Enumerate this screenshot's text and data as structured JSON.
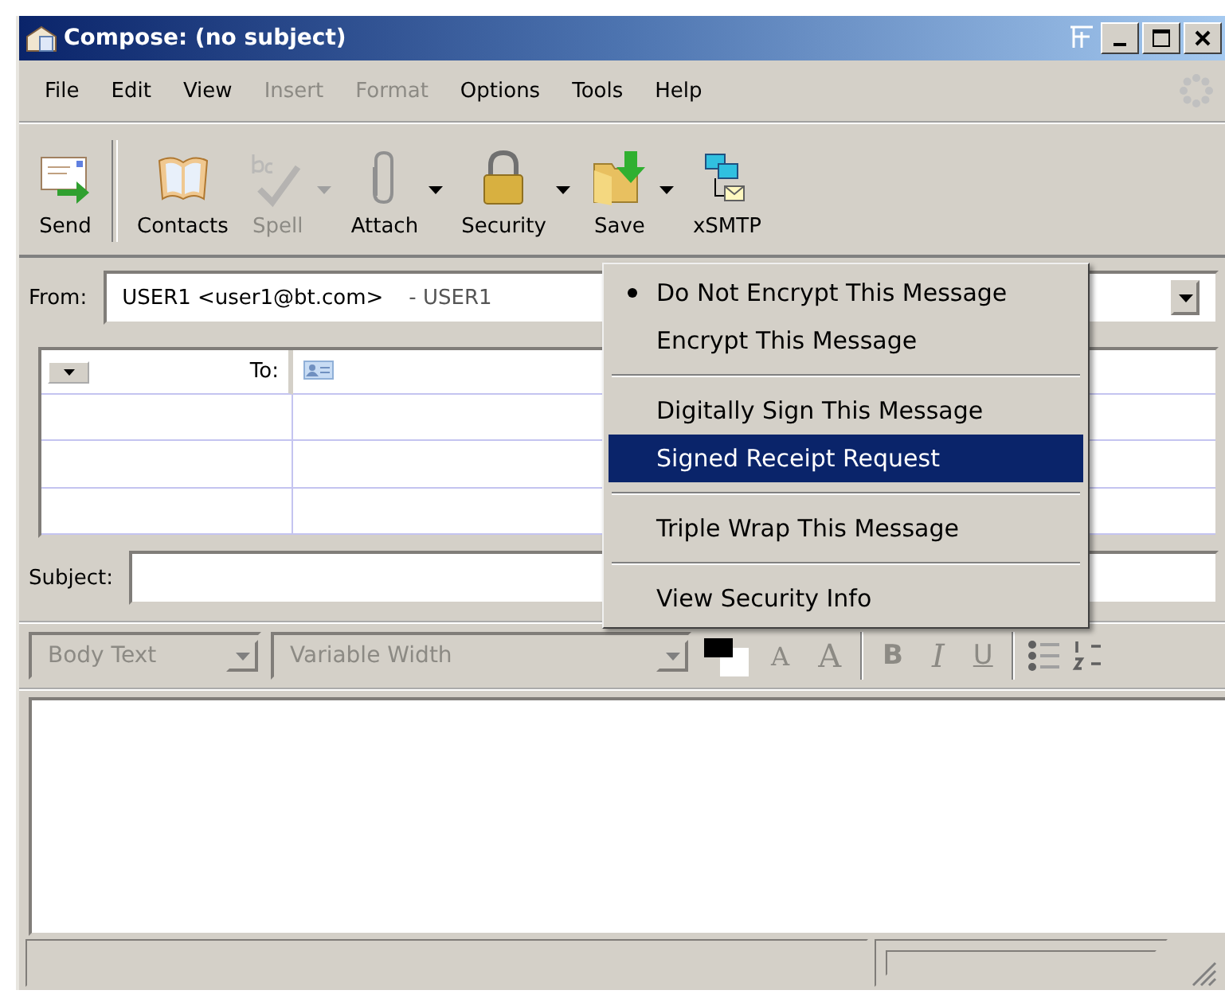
{
  "window": {
    "title": "Compose: (no subject)"
  },
  "menu_bar": [
    {
      "label": "File",
      "disabled": false
    },
    {
      "label": "Edit",
      "disabled": false
    },
    {
      "label": "View",
      "disabled": false
    },
    {
      "label": "Insert",
      "disabled": true
    },
    {
      "label": "Format",
      "disabled": true
    },
    {
      "label": "Options",
      "disabled": false
    },
    {
      "label": "Tools",
      "disabled": false
    },
    {
      "label": "Help",
      "disabled": false
    }
  ],
  "toolbar": [
    {
      "label": "Send",
      "disabled": false,
      "dropdown": false
    },
    {
      "label": "Contacts",
      "disabled": false,
      "dropdown": false
    },
    {
      "label": "Spell",
      "disabled": true,
      "dropdown": true
    },
    {
      "label": "Attach",
      "disabled": false,
      "dropdown": true
    },
    {
      "label": "Security",
      "disabled": false,
      "dropdown": true
    },
    {
      "label": "Save",
      "disabled": false,
      "dropdown": true
    },
    {
      "label": "xSMTP",
      "disabled": false,
      "dropdown": false
    }
  ],
  "from": {
    "label": "From:",
    "value": "USER1 <user1@bt.com>",
    "identity": "- USER1"
  },
  "addressing": {
    "type": "To:"
  },
  "subject": {
    "label": "Subject:"
  },
  "format_bar": {
    "disabled": true,
    "paragraph_style": "Body Text",
    "font": "Variable Width",
    "bold": "B",
    "italic": "I",
    "underline": "U",
    "smaller": "A",
    "larger": "A"
  },
  "security_menu": [
    {
      "kind": "item",
      "label": "Do Not Encrypt This Message",
      "checked": true,
      "highlighted": false
    },
    {
      "kind": "item",
      "label": "Encrypt This Message",
      "checked": false,
      "highlighted": false
    },
    {
      "kind": "separator"
    },
    {
      "kind": "item",
      "label": "Digitally Sign This Message",
      "checked": false,
      "highlighted": false
    },
    {
      "kind": "item",
      "label": "Signed Receipt Request",
      "checked": false,
      "highlighted": true
    },
    {
      "kind": "separator"
    },
    {
      "kind": "item",
      "label": "Triple Wrap This Message",
      "checked": false,
      "highlighted": false
    },
    {
      "kind": "separator"
    },
    {
      "kind": "item",
      "label": "View Security Info",
      "checked": false,
      "highlighted": false
    }
  ]
}
